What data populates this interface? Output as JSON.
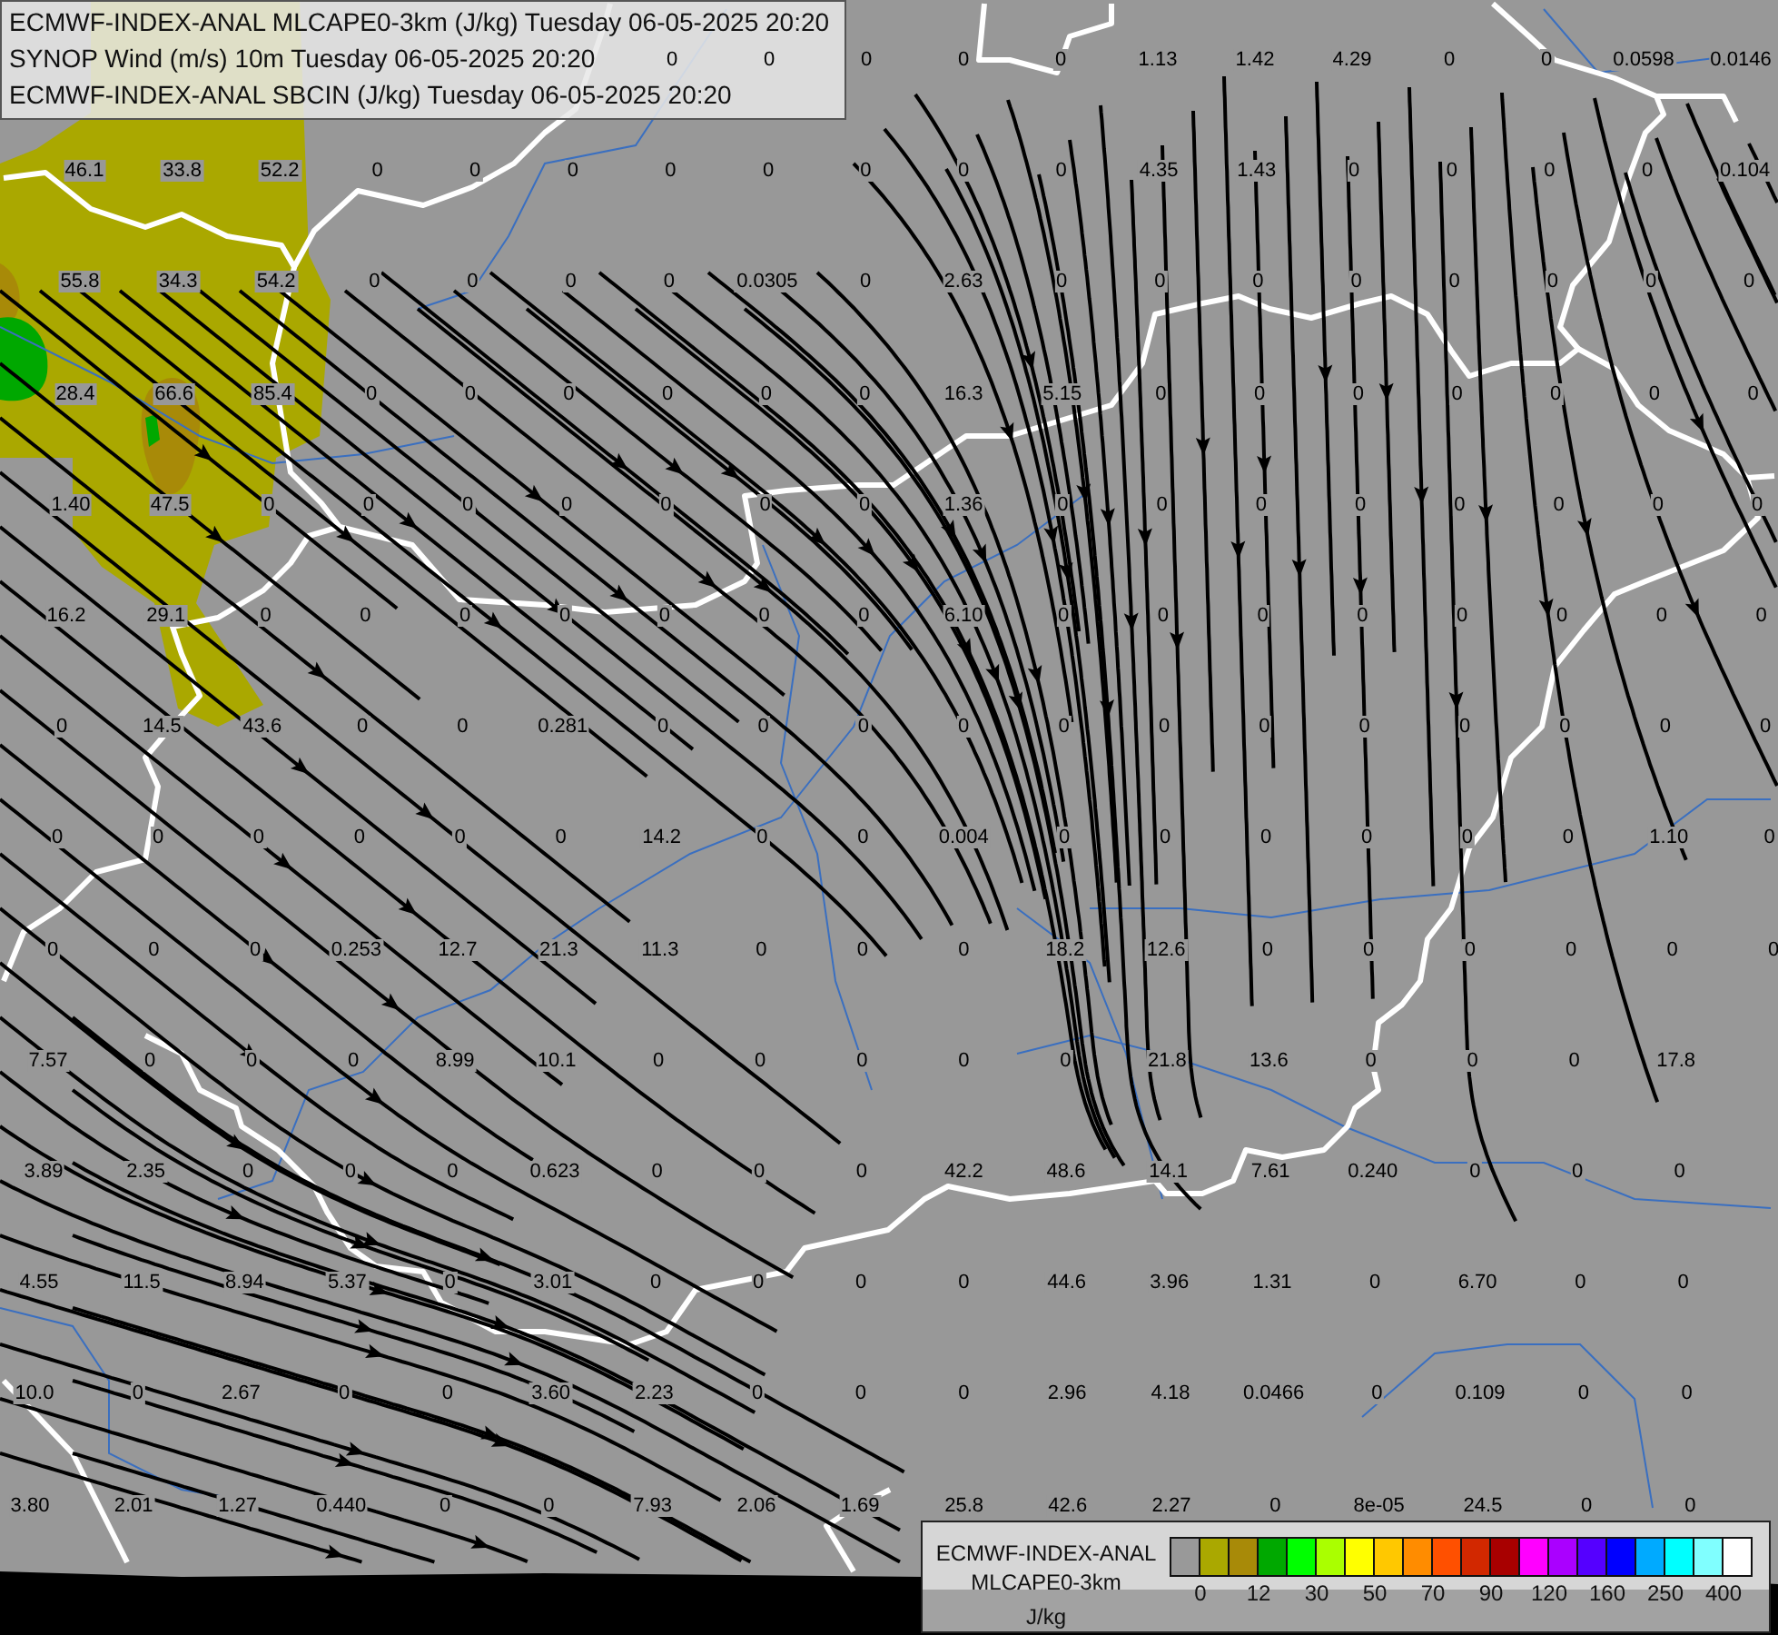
{
  "header": {
    "lines": [
      "ECMWF-INDEX-ANAL MLCAPE0-3km (J/kg) Tuesday 06-05-2025 20:20",
      "SYNOP Wind (m/s) 10m Tuesday 06-05-2025 20:20",
      "ECMWF-INDEX-ANAL SBCIN (J/kg) Tuesday 06-05-2025 20:20"
    ]
  },
  "map": {
    "value_rows": [
      {
        "values": [
          "0",
          "0",
          "0",
          "0",
          "0",
          "1.13",
          "1.42",
          "4.29",
          "0",
          "0",
          "0.0598",
          "0.0146"
        ]
      },
      {
        "values": [
          "46.1",
          "33.8",
          "52.2",
          "0",
          "0",
          "0",
          "0",
          "0",
          "0",
          "0",
          "0",
          "4.35",
          "1.43",
          "0",
          "0",
          "0",
          "0",
          "0.104"
        ]
      },
      {
        "values": [
          "55.8",
          "34.3",
          "54.2",
          "0",
          "0",
          "0",
          "0",
          "0.0305",
          "0",
          "2.63",
          "0",
          "0",
          "0",
          "0",
          "0",
          "0",
          "0",
          "0"
        ]
      },
      {
        "values": [
          "28.4",
          "66.6",
          "85.4",
          "0",
          "0",
          "0",
          "0",
          "0",
          "0",
          "16.3",
          "5.15",
          "0",
          "0",
          "0",
          "0",
          "0",
          "0",
          "0"
        ]
      },
      {
        "values": [
          "1.40",
          "47.5",
          "0",
          "0",
          "0",
          "0",
          "0",
          "0",
          "0",
          "1.36",
          "0",
          "0",
          "0",
          "0",
          "0",
          "0",
          "0",
          "0"
        ]
      },
      {
        "values": [
          "16.2",
          "29.1",
          "0",
          "0",
          "0",
          "0",
          "0",
          "0",
          "0",
          "6.10",
          "0",
          "0",
          "0",
          "0",
          "0",
          "0",
          "0",
          "0"
        ]
      },
      {
        "values": [
          "0",
          "14.5",
          "43.6",
          "0",
          "0",
          "0.281",
          "0",
          "0",
          "0",
          "0",
          "0",
          "0",
          "0",
          "0",
          "0",
          "0",
          "0",
          "0"
        ]
      },
      {
        "values": [
          "0",
          "0",
          "0",
          "0",
          "0",
          "0",
          "14.2",
          "0",
          "0",
          "0.004",
          "0",
          "0",
          "0",
          "0",
          "0",
          "0",
          "1.10",
          "0"
        ]
      },
      {
        "values": [
          "0",
          "0",
          "0",
          "0.253",
          "12.7",
          "21.3",
          "11.3",
          "0",
          "0",
          "0",
          "18.2",
          "12.6",
          "0",
          "0",
          "0",
          "0",
          "0",
          "0"
        ]
      },
      {
        "values": [
          "7.57",
          "0",
          "0",
          "0",
          "8.99",
          "10.1",
          "0",
          "0",
          "0",
          "0",
          "0",
          "21.8",
          "13.6",
          "0",
          "0",
          "0",
          "17.8"
        ]
      },
      {
        "values": [
          "3.89",
          "2.35",
          "0",
          "0",
          "0",
          "0.623",
          "0",
          "0",
          "0",
          "42.2",
          "48.6",
          "14.1",
          "7.61",
          "0.240",
          "0",
          "0",
          "0"
        ]
      },
      {
        "values": [
          "4.55",
          "11.5",
          "8.94",
          "5.37",
          "0",
          "3.01",
          "0",
          "0",
          "0",
          "0",
          "44.6",
          "3.96",
          "1.31",
          "0",
          "6.70",
          "0",
          "0"
        ]
      },
      {
        "values": [
          "10.0",
          "0",
          "2.67",
          "0",
          "0",
          "3.60",
          "2.23",
          "0",
          "0",
          "0",
          "2.96",
          "4.18",
          "0.0466",
          "0",
          "0.109",
          "0",
          "0"
        ]
      },
      {
        "values": [
          "3.80",
          "2.01",
          "1.27",
          "0.440",
          "0",
          "0",
          "7.93",
          "2.06",
          "1.69",
          "25.8",
          "42.6",
          "2.27",
          "0",
          "8e-05",
          "24.5",
          "0",
          "0"
        ]
      }
    ]
  },
  "legend": {
    "title_lines": [
      "ECMWF-INDEX-ANAL",
      "MLCAPE0-3km"
    ],
    "unit": "J/kg",
    "swatches": [
      {
        "color": "#999999"
      },
      {
        "color": "#aaa800"
      },
      {
        "color": "#a88a08"
      },
      {
        "color": "#00a800"
      },
      {
        "color": "#00ff00"
      },
      {
        "color": "#aaff00"
      },
      {
        "color": "#ffff00"
      },
      {
        "color": "#ffc800"
      },
      {
        "color": "#ff8c00"
      },
      {
        "color": "#ff5000"
      },
      {
        "color": "#d22800"
      },
      {
        "color": "#a80000"
      },
      {
        "color": "#ff00ff"
      },
      {
        "color": "#aa00ff"
      },
      {
        "color": "#5500ff"
      },
      {
        "color": "#0000ff"
      },
      {
        "color": "#00aaff"
      },
      {
        "color": "#00ffff"
      },
      {
        "color": "#80ffff"
      },
      {
        "color": "#ffffff"
      }
    ],
    "ticks": [
      "0",
      "12",
      "30",
      "50",
      "70",
      "90",
      "120",
      "160",
      "250",
      "400"
    ]
  }
}
